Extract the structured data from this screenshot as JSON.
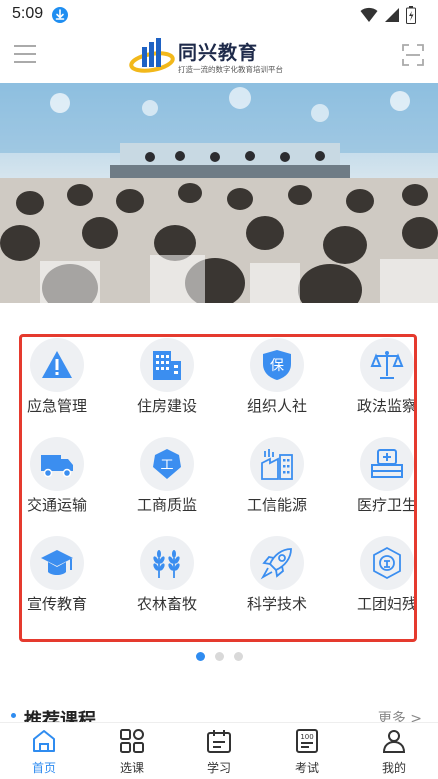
{
  "status_bar": {
    "time": "5:09"
  },
  "header": {
    "logo_title": "同兴教育",
    "logo_subtitle": "打造一流的数字化教育培训平台"
  },
  "categories": [
    {
      "label": "应急管理",
      "icon": "warning-icon"
    },
    {
      "label": "住房建设",
      "icon": "building-icon"
    },
    {
      "label": "组织人社",
      "icon": "shield-bao-icon"
    },
    {
      "label": "政法监察",
      "icon": "scales-icon"
    },
    {
      "label": "交通运输",
      "icon": "truck-icon"
    },
    {
      "label": "工商质监",
      "icon": "badge-gong-icon"
    },
    {
      "label": "工信能源",
      "icon": "factory-icon"
    },
    {
      "label": "医疗卫生",
      "icon": "medical-kit-icon"
    },
    {
      "label": "宣传教育",
      "icon": "graduation-cap-icon"
    },
    {
      "label": "农林畜牧",
      "icon": "wheat-icon"
    },
    {
      "label": "科学技术",
      "icon": "rocket-icon"
    },
    {
      "label": "工团妇残",
      "icon": "union-badge-icon"
    }
  ],
  "pager": {
    "count": 3,
    "active_index": 0
  },
  "recommend": {
    "title": "推荐课程",
    "more": "更多 >"
  },
  "tabbar": [
    {
      "label": "首页",
      "icon": "home-icon",
      "active": true
    },
    {
      "label": "选课",
      "icon": "grid-icon",
      "active": false
    },
    {
      "label": "学习",
      "icon": "study-icon",
      "active": false
    },
    {
      "label": "考试",
      "icon": "exam-icon",
      "active": false
    },
    {
      "label": "我的",
      "icon": "user-icon",
      "active": false
    }
  ],
  "colors": {
    "accent": "#2f8cf0",
    "highlight_frame": "#e53a2e"
  }
}
